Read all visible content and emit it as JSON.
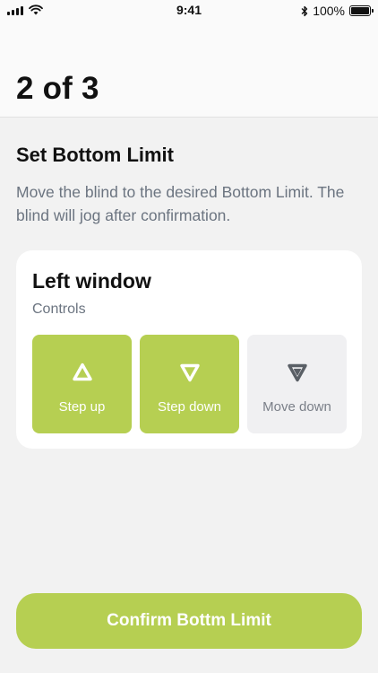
{
  "status_bar": {
    "time": "9:41",
    "battery_percent": "100%",
    "signal_bars": 4,
    "wifi": true,
    "bluetooth": true
  },
  "header": {
    "step_counter": "2 of 3"
  },
  "section": {
    "title": "Set Bottom Limit",
    "instructions": "Move the blind to the desired Bottom Limit. The blind will jog after confirmation."
  },
  "card": {
    "title": "Left window",
    "subtitle": "Controls",
    "controls": [
      {
        "label": "Step up",
        "icon": "triangle-up-icon",
        "state": "active"
      },
      {
        "label": "Step down",
        "icon": "triangle-down-icon",
        "state": "active"
      },
      {
        "label": "Move down",
        "icon": "triangle-down-filled-icon",
        "state": "inactive"
      }
    ]
  },
  "confirm_button": {
    "label": "Confirm Bottm Limit"
  },
  "colors": {
    "accent": "#b6cf52",
    "background": "#f2f2f2",
    "muted_text": "#6b7480",
    "inactive_control": "#f0f0f2",
    "inactive_icon": "#5a5f66"
  }
}
